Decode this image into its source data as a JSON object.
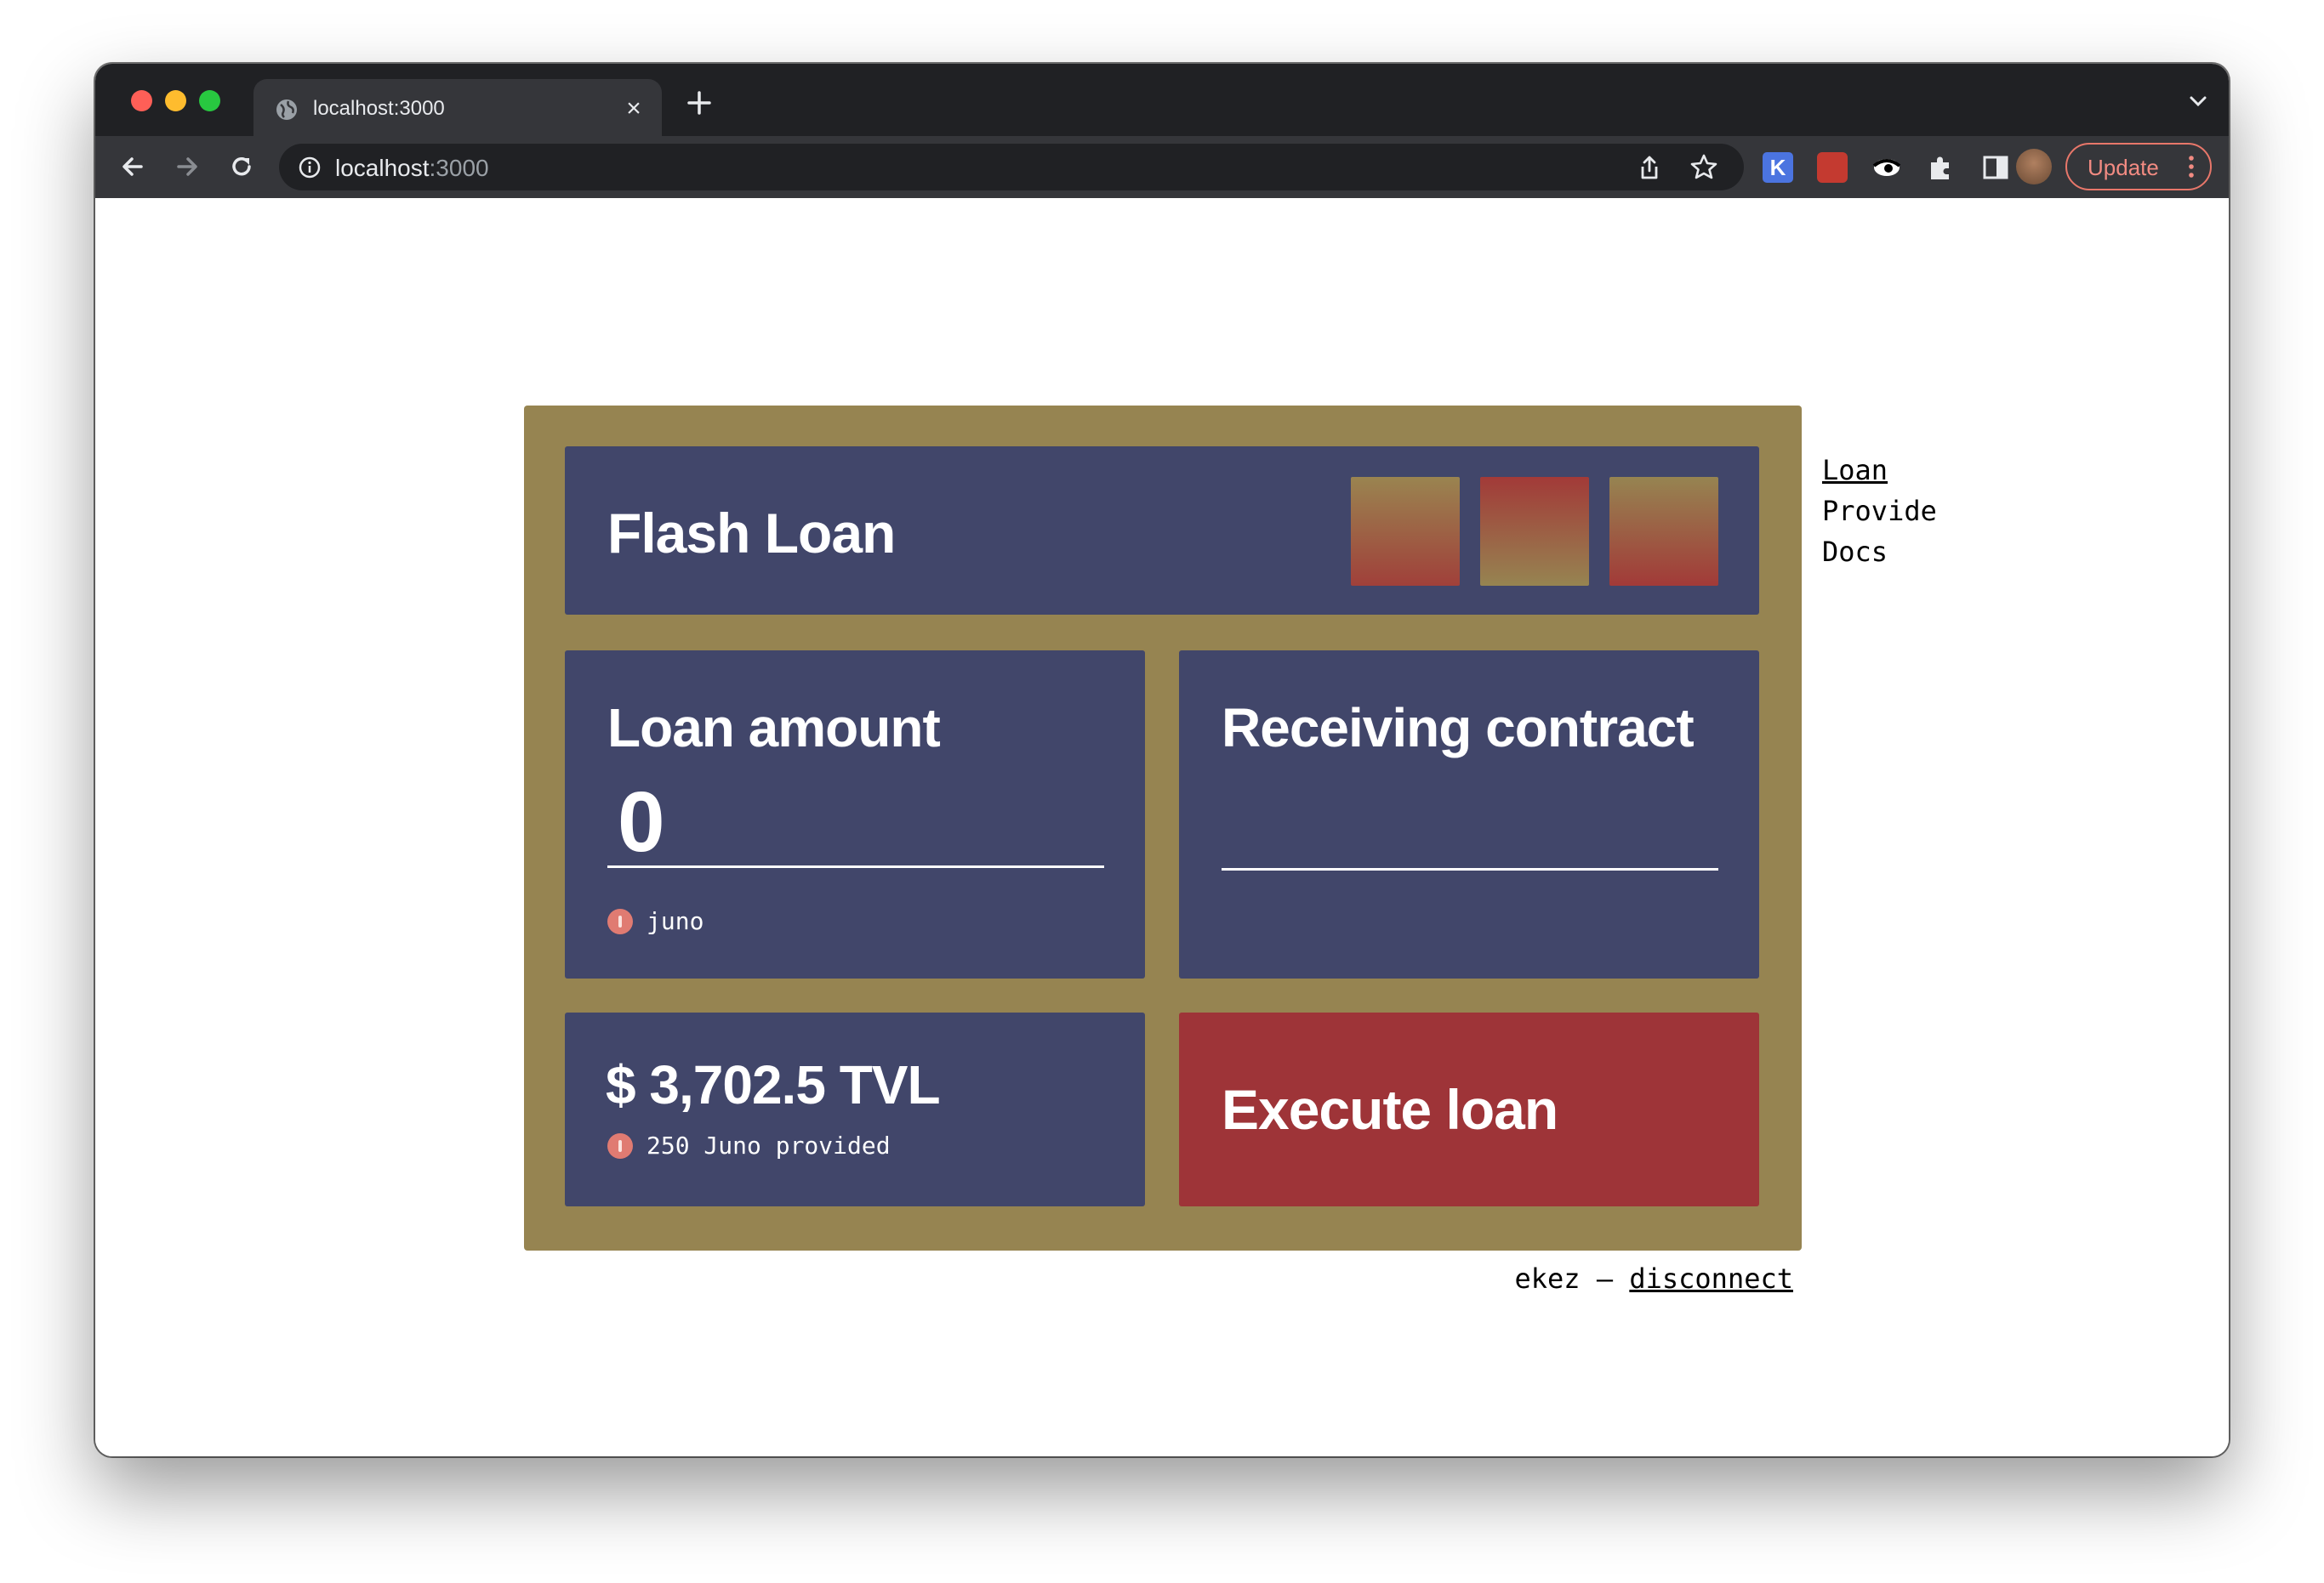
{
  "browser": {
    "tab_title": "localhost:3000",
    "url_host": "localhost",
    "url_port": ":3000",
    "update_label": "Update",
    "extension_k_letter": "K"
  },
  "app": {
    "title": "Flash Loan",
    "loan_amount": {
      "title": "Loan amount",
      "value": "0",
      "denom": "juno"
    },
    "receiving_contract": {
      "title": "Receiving contract",
      "value": ""
    },
    "tvl": {
      "value": "$ 3,702.5 TVL",
      "provided": "250 Juno provided"
    },
    "execute_label": "Execute loan",
    "colors": {
      "frame": "#968451",
      "panel": "#41466a",
      "execute": "#9e3438",
      "juno_icon": "#e07b72"
    }
  },
  "nav": {
    "items": [
      {
        "label": "Loan",
        "active": true
      },
      {
        "label": "Provide",
        "active": false
      },
      {
        "label": "Docs",
        "active": false
      }
    ]
  },
  "footer": {
    "user": "ekez",
    "separator": " – ",
    "disconnect": "disconnect"
  }
}
